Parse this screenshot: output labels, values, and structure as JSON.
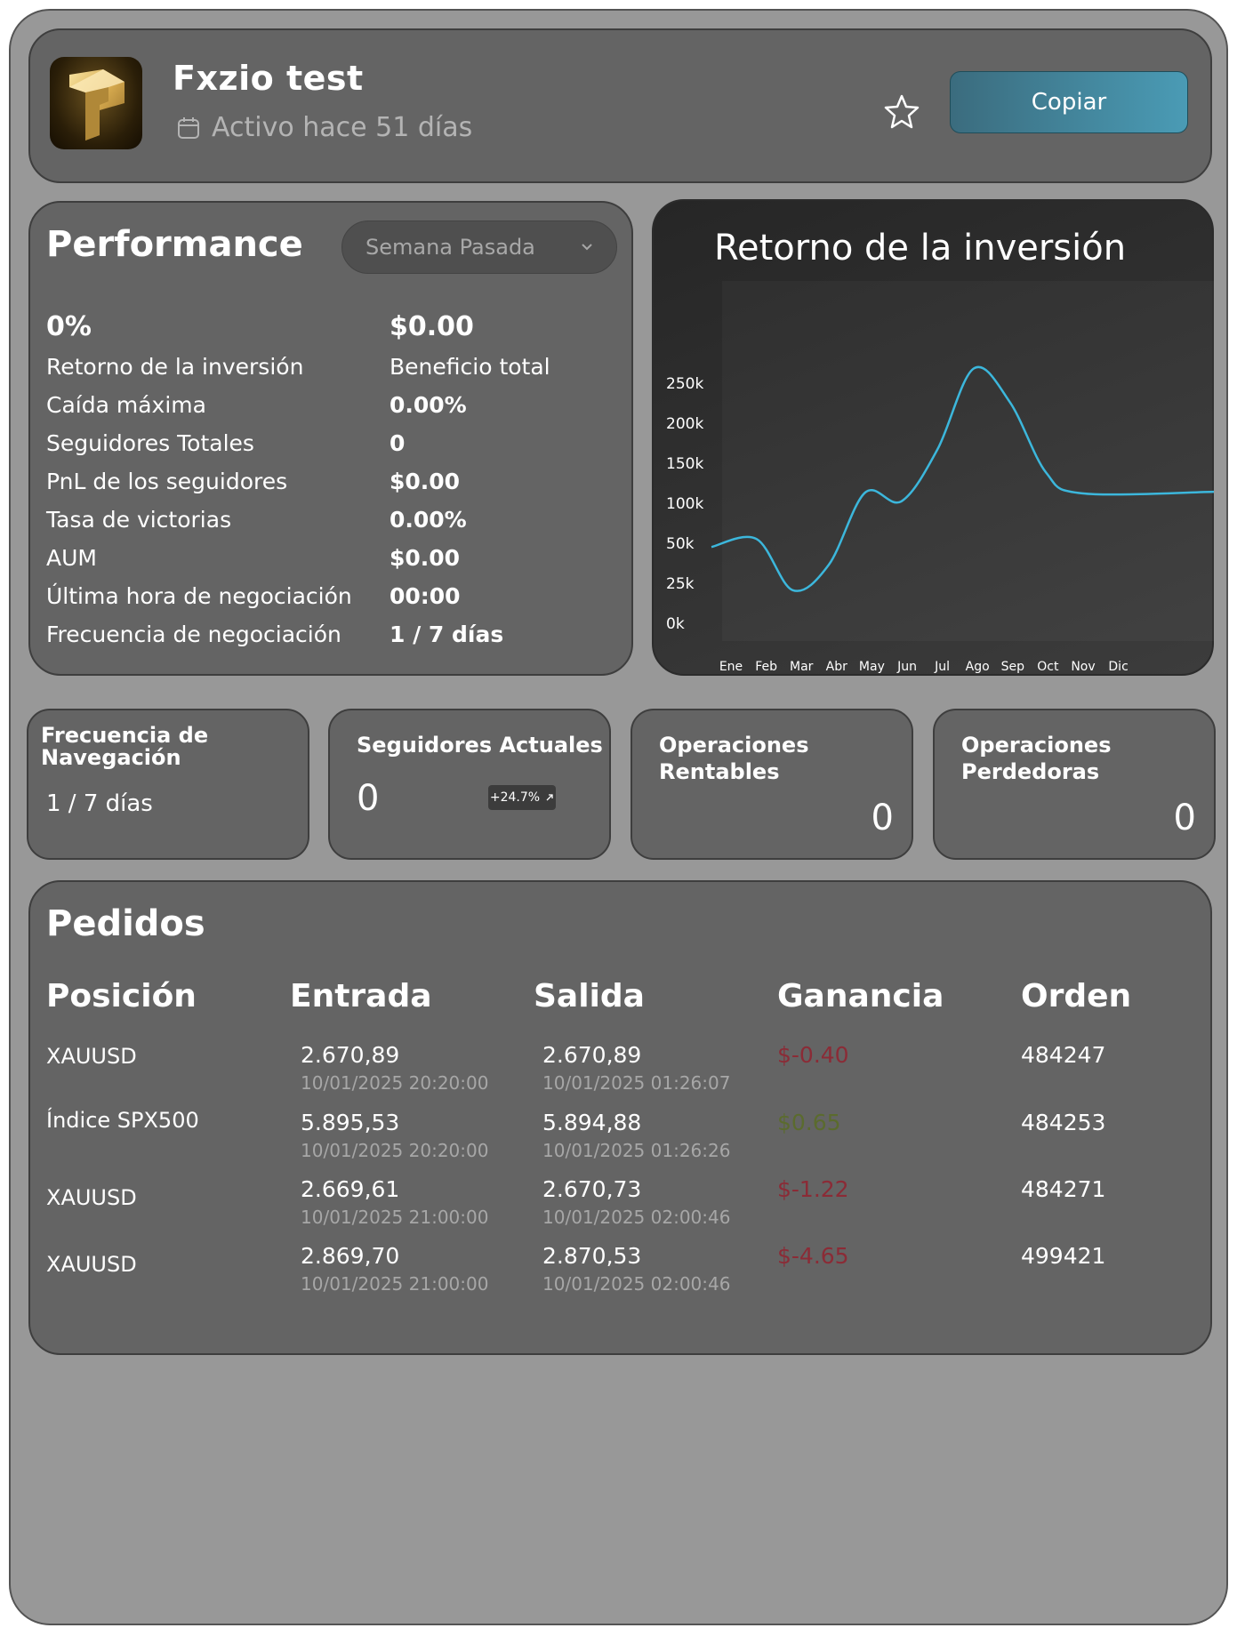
{
  "header": {
    "trader_name": "Fxzio test",
    "active_text": "Activo hace 51 días",
    "copy_label": "Copiar",
    "accent_gradient": [
      "#3b6c7e",
      "#4a9bb5"
    ]
  },
  "performance": {
    "title": "Performance",
    "period": "Semana Pasada",
    "roi_value": "0%",
    "profit_value": "$0.00",
    "roi_label": "Retorno de la inversión",
    "profit_label": "Beneficio total",
    "stats": [
      {
        "label": "Caída máxima",
        "value": "0.00%"
      },
      {
        "label": "Seguidores Totales",
        "value": "0"
      },
      {
        "label": "PnL de los seguidores",
        "value": "$0.00"
      },
      {
        "label": "Tasa de victorias",
        "value": "0.00%"
      },
      {
        "label": "AUM",
        "value": "$0.00"
      },
      {
        "label": "Última hora de negociación",
        "value": "00:00"
      },
      {
        "label": "Frecuencia de negociación",
        "value": "1 / 7 días"
      }
    ]
  },
  "roi_chart": {
    "title": "Retorno de la inversión"
  },
  "chart_data": {
    "type": "line",
    "title": "Retorno de la inversión",
    "categories": [
      "Ene",
      "Feb",
      "Mar",
      "Abr",
      "May",
      "Jun",
      "Jul",
      "Ago",
      "Sep",
      "Oct",
      "Nov",
      "Dic"
    ],
    "y_ticks": [
      "0k",
      "25k",
      "50k",
      "100k",
      "150k",
      "200k",
      "250k"
    ],
    "series": [
      {
        "values": [
          52000,
          62000,
          24000,
          40000,
          120000,
          109000,
          174000,
          275000,
          233000,
          145000,
          119000,
          121000
        ],
        "color": "#3cb7dc"
      }
    ],
    "grid": false
  },
  "stat_cards": {
    "nav_freq_title": "Frecuencia de Navegación",
    "nav_freq_value": "1 / 7 días",
    "followers_title": "Seguidores Actuales",
    "followers_value": "0",
    "followers_trend": "+24.7%",
    "profitable_title": "Operaciones Rentables",
    "profitable_value": "0",
    "losing_title": "Operaciones Perdedoras",
    "losing_value": "0"
  },
  "orders": {
    "title": "Pedidos",
    "columns": [
      "Posición",
      "Entrada",
      "Salida",
      "Ganancia",
      "Orden"
    ],
    "rows": [
      {
        "symbol": "XAUUSD",
        "entry_price": "2.670,89",
        "entry_time": "10/01/2025 20:20:00",
        "exit_price": "2.670,89",
        "exit_time": "10/01/2025 01:26:07",
        "profit": "$-0.40",
        "order": "484247"
      },
      {
        "symbol": "Índice SPX500",
        "entry_price": "5.895,53",
        "entry_time": "10/01/2025 20:20:00",
        "exit_price": "5.894,88",
        "exit_time": "10/01/2025 01:26:26",
        "profit": "$0.65",
        "order": "484253"
      },
      {
        "symbol": "XAUUSD",
        "entry_price": "2.669,61",
        "entry_time": "10/01/2025 21:00:00",
        "exit_price": "2.670,73",
        "exit_time": "10/01/2025 02:00:46",
        "profit": "$-1.22",
        "order": "484271"
      },
      {
        "symbol": "XAUUSD",
        "entry_price": "2.869,70",
        "entry_time": "10/01/2025 21:00:00",
        "exit_price": "2.870,53",
        "exit_time": "10/01/2025 02:00:46",
        "profit": "$-4.65",
        "order": "499421"
      }
    ],
    "loss_color": "#8b2b36",
    "gain_color": "#5b6b2e"
  }
}
